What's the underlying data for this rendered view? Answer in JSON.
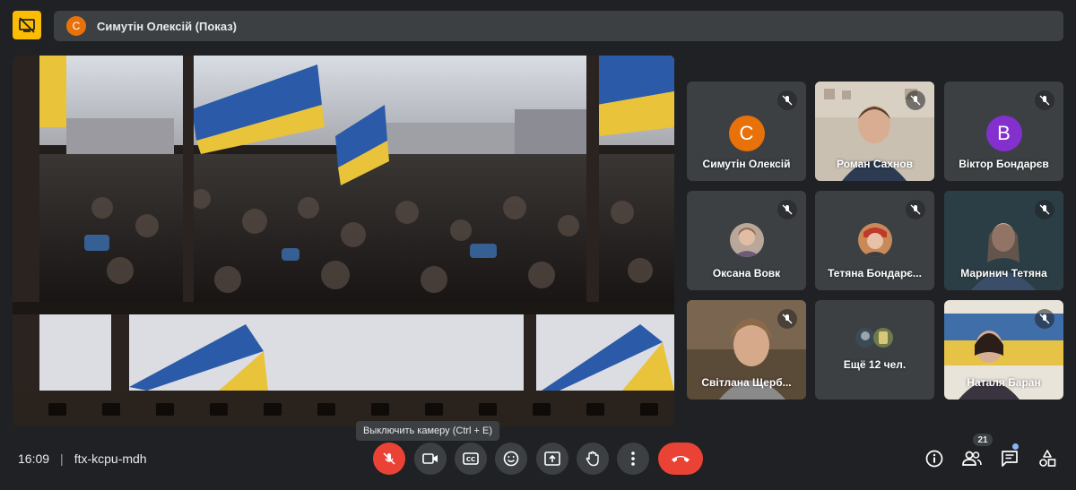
{
  "presenter": {
    "initial": "С",
    "avatar_color": "#e8710a",
    "label": "Симутін Олексій (Показ)"
  },
  "tiles": [
    {
      "name": "Симутін Олексій",
      "initial": "С",
      "color": "#e8710a",
      "kind": "letter"
    },
    {
      "name": "Роман Сахнов",
      "kind": "video"
    },
    {
      "name": "Віктор Бондарєв",
      "initial": "В",
      "color": "#8430ce",
      "kind": "letter"
    },
    {
      "name": "Оксана Вовк",
      "kind": "photo"
    },
    {
      "name": "Тетяна Бондарє...",
      "kind": "photo"
    },
    {
      "name": "Маринич Тетяна",
      "kind": "video"
    },
    {
      "name": "Світлана Щерб...",
      "kind": "video"
    },
    {
      "name": "Ещё 12 чел.",
      "kind": "more"
    },
    {
      "name": "Наталя Баран",
      "kind": "video"
    }
  ],
  "tooltip": "Выключить камеру (Ctrl + E)",
  "meeting": {
    "time": "16:09",
    "code": "ftx-kcpu-mdh"
  },
  "people_count": "21",
  "icons": {
    "top_left": "present-off-icon",
    "mic": "mic-off-icon",
    "camera": "videocam-icon",
    "captions": "captions-icon",
    "emoji": "emoji-icon",
    "present": "present-screen-icon",
    "hand": "raise-hand-icon",
    "more": "more-vert-icon",
    "end": "call-end-icon",
    "info": "info-icon",
    "people": "people-icon",
    "chat": "chat-icon",
    "activities": "activities-icon"
  },
  "colors": {
    "background": "#202124",
    "surface": "#3c4043",
    "danger": "#ea4335",
    "accent_yellow": "#fbbc04"
  }
}
